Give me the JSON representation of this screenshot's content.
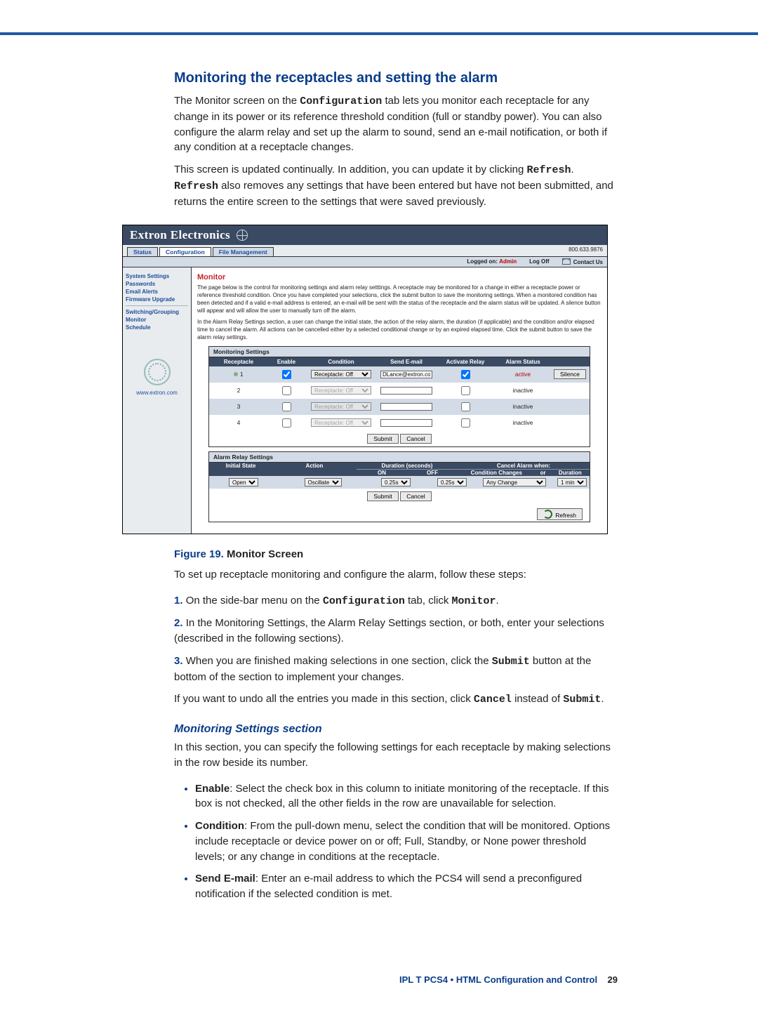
{
  "section_title": "Monitoring the receptacles and setting the alarm",
  "para1_a": "The Monitor screen on the ",
  "para1_b": "Configuration",
  "para1_c": " tab lets you monitor each receptacle for any change in its power or its reference threshold condition (full or standby power). You can also configure the alarm relay and set up the alarm to sound, send an e-mail notification, or both if any condition at a receptacle changes.",
  "para2_a": "This screen is updated continually. In addition, you can update it by clicking ",
  "para2_b": "Refresh",
  "para2_c": ". ",
  "para2_d": "Refresh",
  "para2_e": " also removes any settings that have been entered but have not been submitted, and returns the entire screen to the settings that were saved previously.",
  "app": {
    "brand": "Extron Electronics",
    "tabs": [
      "Status",
      "Configuration",
      "File Management"
    ],
    "phone": "800.633.9876",
    "info": {
      "logged": "Logged on:",
      "user": "Admin",
      "logoff": "Log Off",
      "contact": "Contact Us"
    },
    "sidebar": {
      "items1": [
        "System Settings",
        "Passwords",
        "Email Alerts",
        "Firmware Upgrade"
      ],
      "items2": [
        "Switching/Grouping",
        "Monitor",
        "Schedule"
      ],
      "url": "www.extron.com"
    },
    "main": {
      "title": "Monitor",
      "desc1": "The page below is the control for monitoring settings and alarm relay setttings. A receptacle may be monitored for a change in either a receptacle power or reference threshold condition. Once you have completed your selections, click the submit button to save the monitoring settings. When a monitored condition has been detected and if a valid e-mail address is entered, an e-mail will be sent with the status of the receptacle and the alarm status will be updated. A silence button will appear and will allow the user to manually turn off the alarm.",
      "desc2": "In the Alarm Relay Settings section, a user can change the initial state, the action of the relay alarm, the duration (if applicable) and the condition and/or elapsed time to cancel the alarm. All actions can be cancelled either by a selected conditional change or by an expired elapsed time. Click the submit button to save the alarm relay settings.",
      "monitoring": {
        "panel_title": "Monitoring Settings",
        "headers": {
          "rec": "Receptacle",
          "en": "Enable",
          "cond": "Condition",
          "mail": "Send E-mail",
          "act": "Activate Relay",
          "stat": "Alarm Status"
        },
        "rows": [
          {
            "id": "1",
            "dot": true,
            "enabled": true,
            "cond": "Receptacle: Off",
            "cond_disabled": false,
            "email": "DLance@extron.com",
            "relay": true,
            "status": "active",
            "status_color": "red",
            "silence": true
          },
          {
            "id": "2",
            "dot": false,
            "enabled": false,
            "cond": "Receptacle: Off",
            "cond_disabled": true,
            "email": "",
            "relay": false,
            "status": "inactive",
            "status_color": "",
            "silence": false
          },
          {
            "id": "3",
            "dot": false,
            "enabled": false,
            "cond": "Receptacle: Off",
            "cond_disabled": true,
            "email": "",
            "relay": false,
            "status": "inactive",
            "status_color": "",
            "silence": false
          },
          {
            "id": "4",
            "dot": false,
            "enabled": false,
            "cond": "Receptacle: Off",
            "cond_disabled": true,
            "email": "",
            "relay": false,
            "status": "inactive",
            "status_color": "",
            "silence": false
          }
        ],
        "submit": "Submit",
        "cancel": "Cancel",
        "silence": "Silence"
      },
      "relay": {
        "panel_title": "Alarm Relay Settings",
        "headers": {
          "init": "Initial State",
          "action": "Action",
          "dur": "Duration (seconds)",
          "on": "ON",
          "off": "OFF",
          "cancel": "Cancel Alarm when:",
          "cond": "Condition Changes",
          "or": "or",
          "dur2": "Duration"
        },
        "values": {
          "init": "Open",
          "action": "Oscillate",
          "on": "0.25s",
          "off": "0.25s",
          "cond": "Any Change",
          "dur": "1 min"
        },
        "submit": "Submit",
        "cancel": "Cancel",
        "refresh": "Refresh"
      }
    }
  },
  "fig": {
    "num": "Figure 19.",
    "title": " Monitor Screen"
  },
  "intro_steps": "To set up receptacle monitoring and configure the alarm, follow these steps:",
  "steps": [
    {
      "n": "1.",
      "pre": "On the side-bar menu on the ",
      "m1": "Configuration",
      "mid": " tab, click ",
      "m2": "Monitor",
      "post": "."
    },
    {
      "n": "2.",
      "text": "In the Monitoring Settings, the Alarm Relay Settings section, or both, enter your selections (described in the following sections)."
    },
    {
      "n": "3.",
      "pre": "When you are finished making selections in one section, click the ",
      "m1": "Submit",
      "post": " button at the bottom of the section to implement your changes.",
      "extra_pre": "If you want to undo all the entries you made in this section, click ",
      "extra_m1": "Cancel",
      "extra_mid": " instead of ",
      "extra_m2": "Submit",
      "extra_post": "."
    }
  ],
  "subsec_title": "Monitoring Settings section",
  "subsec_intro": "In this section, you can specify the following settings for each receptacle by making selections in the row beside its number.",
  "bullets": [
    {
      "b": "Enable",
      "text": ": Select the check box in this column to initiate monitoring of the receptacle. If this box is not checked, all the other fields in the row are unavailable for selection."
    },
    {
      "b": "Condition",
      "text": ": From the pull-down menu, select the condition that will be monitored. Options include receptacle or device power on or off; Full, Standby, or None power threshold levels; or any change in conditions at the receptacle."
    },
    {
      "b": "Send E-mail",
      "text": ": Enter an e-mail address to which the PCS4 will send a preconfigured notification if the selected condition is met."
    }
  ],
  "footer": {
    "blue": "IPL T PCS4 • HTML Configuration and Control",
    "page": "29"
  }
}
